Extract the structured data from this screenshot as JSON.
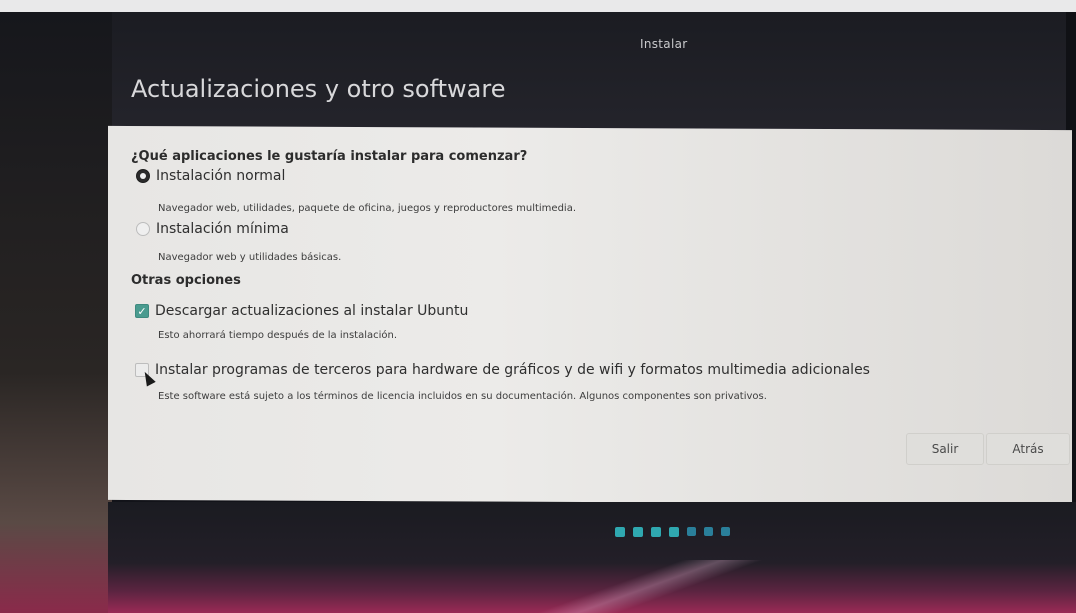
{
  "window": {
    "title": "Instalar"
  },
  "page": {
    "title": "Actualizaciones y otro software"
  },
  "question": "¿Qué aplicaciones le gustaría instalar para comenzar?",
  "install_options": [
    {
      "label": "Instalación normal",
      "description": "Navegador web, utilidades, paquete de oficina, juegos y reproductores multimedia.",
      "selected": true
    },
    {
      "label": "Instalación mínima",
      "description": "Navegador web y utilidades básicas.",
      "selected": false
    }
  ],
  "other_options": {
    "heading": "Otras opciones",
    "items": [
      {
        "label": "Descargar actualizaciones al instalar Ubuntu",
        "description": "Esto ahorrará tiempo después de la instalación.",
        "checked": true
      },
      {
        "label": "Instalar programas de terceros para hardware de gráficos y de wifi y formatos multimedia adicionales",
        "description": "Este software está sujeto a los términos de licencia incluidos en su documentación. Algunos componentes son privativos.",
        "checked": false
      }
    ]
  },
  "buttons": {
    "quit": "Salir",
    "back": "Atrás"
  },
  "progress": {
    "total_steps": 7,
    "completed_steps": 4
  },
  "colors": {
    "accent_check": "#4a9b8f",
    "progress_dot": "#2fa8b0"
  }
}
